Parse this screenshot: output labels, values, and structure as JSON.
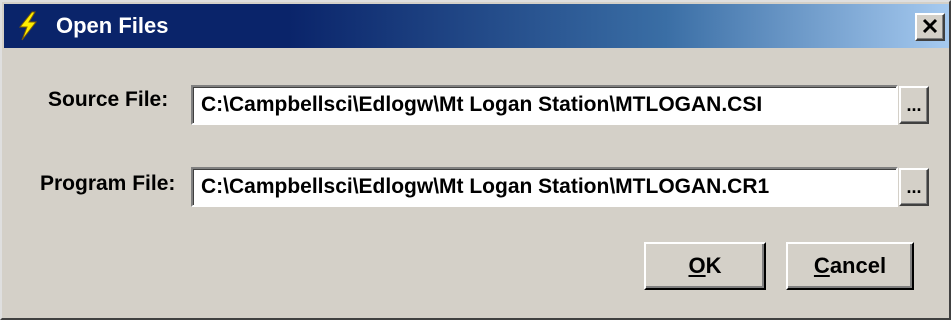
{
  "window": {
    "title": "Open Files",
    "title_icon": "lightning-bolt-icon",
    "close_label": "✕",
    "close_icon": "close-icon"
  },
  "source": {
    "label": "Source File:",
    "value": "C:\\Campbellsci\\Edlogw\\Mt Logan Station\\MTLOGAN.CSI",
    "browse_label": "..."
  },
  "program": {
    "label": "Program File:",
    "value": "C:\\Campbellsci\\Edlogw\\Mt Logan Station\\MTLOGAN.CR1",
    "browse_label": "..."
  },
  "buttons": {
    "ok_accel": "O",
    "ok_rest": "K",
    "cancel_accel": "C",
    "cancel_rest": "ancel"
  },
  "colors": {
    "titlebar_start": "#0a246a",
    "titlebar_end": "#a6caf0",
    "face": "#d4d0c8",
    "bolt": "#ffee00"
  }
}
